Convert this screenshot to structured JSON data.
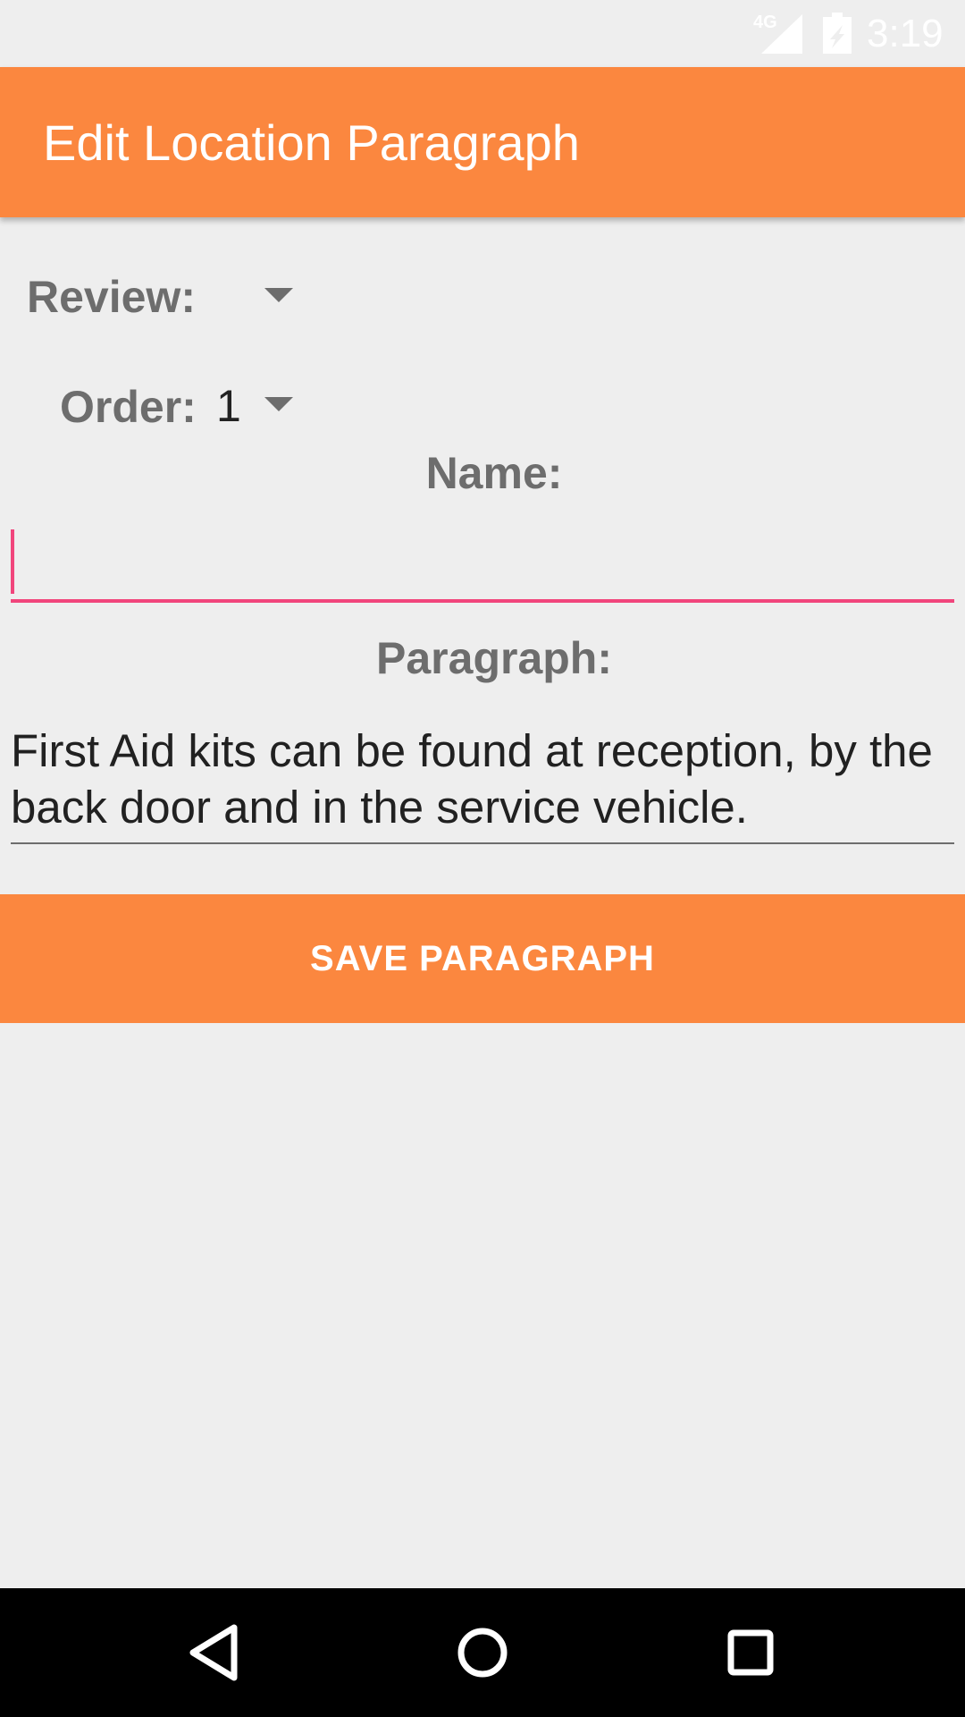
{
  "status_bar": {
    "network": "4G",
    "time": "3:19",
    "icons": [
      "signal-icon",
      "battery-icon"
    ]
  },
  "app_bar": {
    "title": "Edit Location Paragraph"
  },
  "form": {
    "review_label": "Review:",
    "review_value": "",
    "order_label": "Order:",
    "order_value": "1",
    "name_label": "Name:",
    "name_value": "",
    "paragraph_label": "Paragraph:",
    "paragraph_value": "First Aid kits can be found at reception, by the back door and in the service vehicle.",
    "save_label": "SAVE PARAGRAPH"
  },
  "nav_bar": {
    "icons": [
      "back-icon",
      "home-icon",
      "recents-icon"
    ]
  },
  "colors": {
    "accent": "#fb873f",
    "focus": "#f1457c",
    "label": "#6d6d6d",
    "background": "#eeeeee"
  }
}
